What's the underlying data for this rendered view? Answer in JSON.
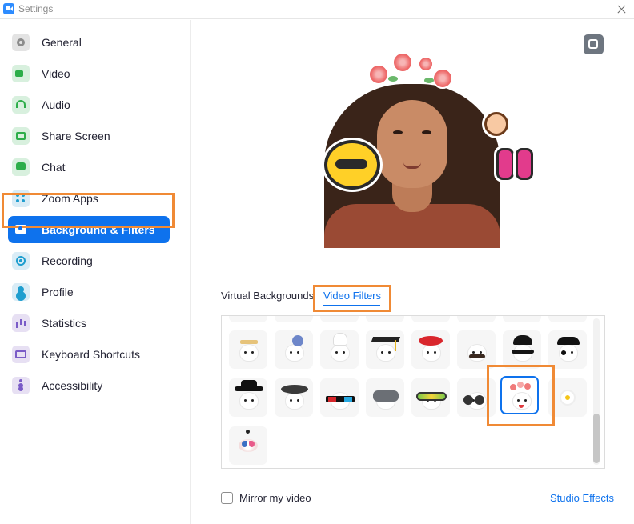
{
  "window": {
    "title": "Settings"
  },
  "sidebar": {
    "items": [
      {
        "label": "General",
        "icon": "gear-icon"
      },
      {
        "label": "Video",
        "icon": "video-camera-icon"
      },
      {
        "label": "Audio",
        "icon": "headphones-icon"
      },
      {
        "label": "Share Screen",
        "icon": "share-screen-icon"
      },
      {
        "label": "Chat",
        "icon": "chat-bubble-icon"
      },
      {
        "label": "Zoom Apps",
        "icon": "apps-grid-icon"
      },
      {
        "label": "Background & Filters",
        "icon": "person-background-icon",
        "active": true
      },
      {
        "label": "Recording",
        "icon": "record-icon"
      },
      {
        "label": "Profile",
        "icon": "profile-person-icon"
      },
      {
        "label": "Statistics",
        "icon": "bar-chart-icon"
      },
      {
        "label": "Keyboard Shortcuts",
        "icon": "keyboard-icon"
      },
      {
        "label": "Accessibility",
        "icon": "accessibility-icon"
      }
    ]
  },
  "tabs": {
    "virtual_backgrounds": "Virtual Backgrounds",
    "video_filters": "Video Filters",
    "active": "Video Filters"
  },
  "filters": [
    "crown-face",
    "flower-hair-face",
    "chef-hat-face",
    "graduation-cap-face",
    "red-beret-face",
    "mustache-face",
    "bandit-mask-face",
    "pirate-face",
    "black-hat-face",
    "beret-face",
    "3d-glasses-face",
    "vr-headset-face",
    "ski-goggles-face",
    "round-sunglasses-face",
    "flower-crown-face",
    "daisy-face",
    "butterfly-face"
  ],
  "selected_filter": "flower-crown-face",
  "bottom": {
    "mirror_label": "Mirror my video",
    "mirror_checked": false,
    "studio_effects": "Studio Effects"
  },
  "colors": {
    "accent": "#0e72ed",
    "highlight": "#f08a35"
  }
}
